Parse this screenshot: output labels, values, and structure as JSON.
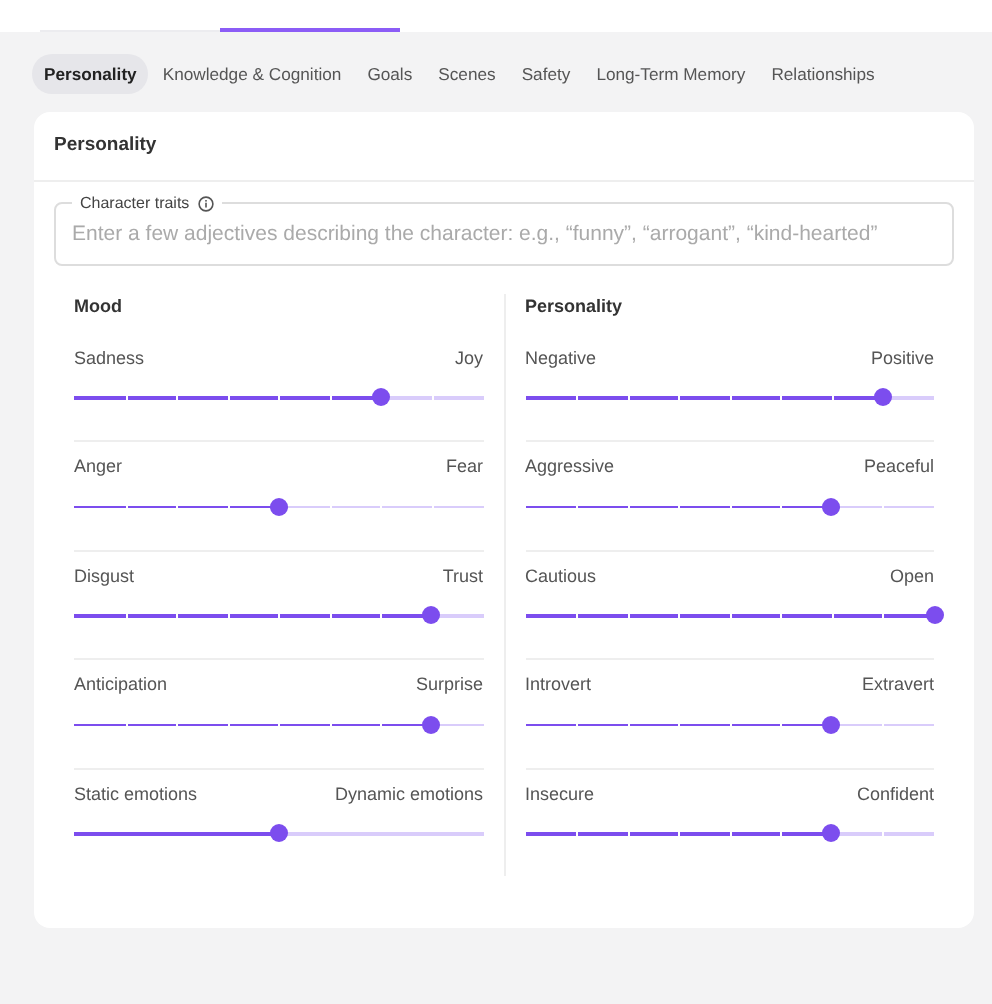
{
  "top_tabs": [
    {
      "selected": false
    },
    {
      "selected": true
    }
  ],
  "tabs": [
    {
      "label": "Personality",
      "selected": true
    },
    {
      "label": "Knowledge & Cognition",
      "selected": false
    },
    {
      "label": "Goals",
      "selected": false
    },
    {
      "label": "Scenes",
      "selected": false
    },
    {
      "label": "Safety",
      "selected": false
    },
    {
      "label": "Long-Term Memory",
      "selected": false
    },
    {
      "label": "Relationships",
      "selected": false
    }
  ],
  "card": {
    "title": "Personality",
    "traits_field": {
      "label": "Character traits",
      "placeholder": "Enter a few adjectives describing the character: e.g., “funny”, “arrogant”, “kind-hearted”"
    },
    "columns": [
      {
        "title": "Mood",
        "sliders": [
          {
            "left": "Sadness",
            "right": "Joy",
            "kind": "stepped",
            "level": 0.75
          },
          {
            "left": "Anger",
            "right": "Fear",
            "kind": "stepped",
            "level": 0.5
          },
          {
            "left": "Disgust",
            "right": "Trust",
            "kind": "stepped",
            "level": 0.875
          },
          {
            "left": "Anticipation",
            "right": "Surprise",
            "kind": "stepped",
            "level": 0.875
          },
          {
            "left": "Static emotions",
            "right": "Dynamic emotions",
            "kind": "continuous",
            "level": 0.5
          }
        ]
      },
      {
        "title": "Personality",
        "sliders": [
          {
            "left": "Negative",
            "right": "Positive",
            "kind": "stepped",
            "level": 0.875
          },
          {
            "left": "Aggressive",
            "right": "Peaceful",
            "kind": "stepped",
            "level": 0.75
          },
          {
            "left": "Cautious",
            "right": "Open",
            "kind": "stepped",
            "level": 1
          },
          {
            "left": "Introvert",
            "right": "Extravert",
            "kind": "stepped",
            "level": 0.75
          },
          {
            "left": "Insecure",
            "right": "Confident",
            "kind": "stepped",
            "level": 0.75
          }
        ]
      }
    ]
  }
}
